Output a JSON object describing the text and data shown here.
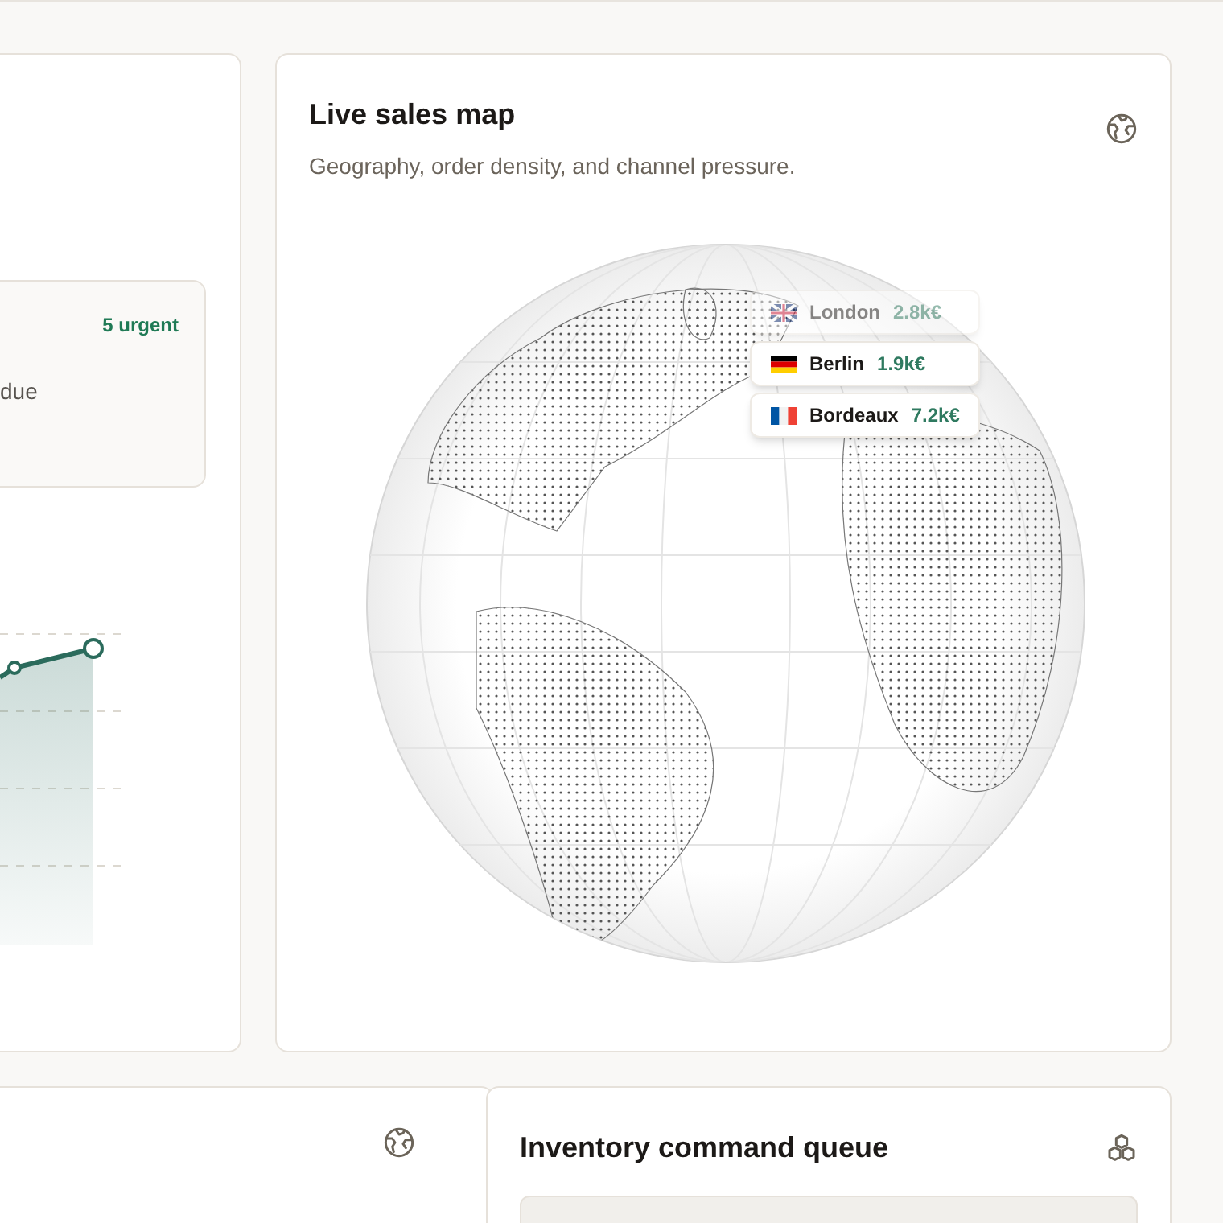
{
  "left_card": {
    "alert": {
      "badge": "5 urgent",
      "text": "due"
    }
  },
  "map_card": {
    "title": "Live sales map",
    "subtitle": "Geography, order density, and channel pressure.",
    "markers": [
      {
        "kind": "uk",
        "city": "London",
        "value": "2.8k€",
        "faded": true
      },
      {
        "kind": "germany",
        "city": "Berlin",
        "value": "1.9k€",
        "faded": false
      },
      {
        "kind": "france",
        "city": "Bordeaux",
        "value": "7.2k€",
        "faded": false
      }
    ]
  },
  "bottom_right_card": {
    "title": "Inventory command queue"
  }
}
